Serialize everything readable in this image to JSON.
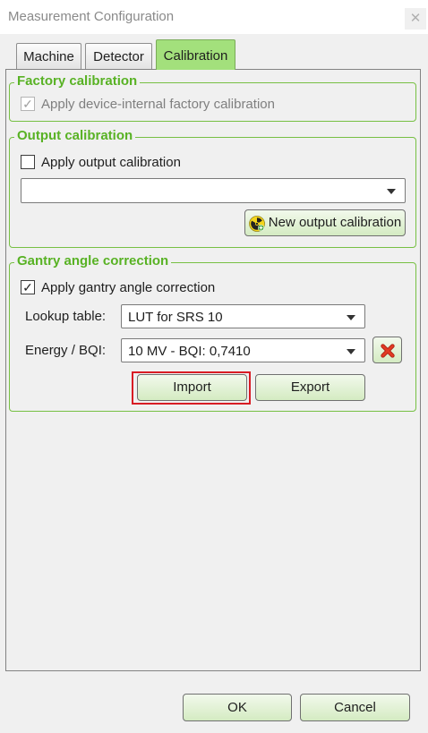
{
  "window": {
    "title": "Measurement Configuration",
    "close_glyph": "✕"
  },
  "tabs": [
    {
      "label": "Machine"
    },
    {
      "label": "Detector"
    },
    {
      "label": "Calibration",
      "active": true
    }
  ],
  "factory_calibration": {
    "legend": "Factory calibration",
    "checkbox_label": "Apply device-internal factory calibration",
    "checked": true,
    "enabled": false
  },
  "output_calibration": {
    "legend": "Output calibration",
    "checkbox_label": "Apply output calibration",
    "checked": false,
    "selected": "",
    "new_button_label": "New output calibration",
    "new_button_icon": "radiation-icon"
  },
  "gantry_angle_correction": {
    "legend": "Gantry angle correction",
    "checkbox_label": "Apply gantry angle correction",
    "checked": true,
    "lookup_table_label": "Lookup table:",
    "lookup_table_value": "LUT for SRS 10",
    "energy_label": "Energy / BQI:",
    "energy_value": "10 MV - BQI: 0,7410",
    "delete_icon": "delete-x-icon",
    "import_label": "Import",
    "export_label": "Export"
  },
  "footer": {
    "ok_label": "OK",
    "cancel_label": "Cancel"
  },
  "colors": {
    "accent_green": "#58b224",
    "active_tab": "#a3e07c",
    "button_gradient_top": "#f2f9ec",
    "button_gradient_bottom": "#d4ebc2",
    "highlight_red": "#d81c24",
    "delete_red": "#e23a22"
  }
}
